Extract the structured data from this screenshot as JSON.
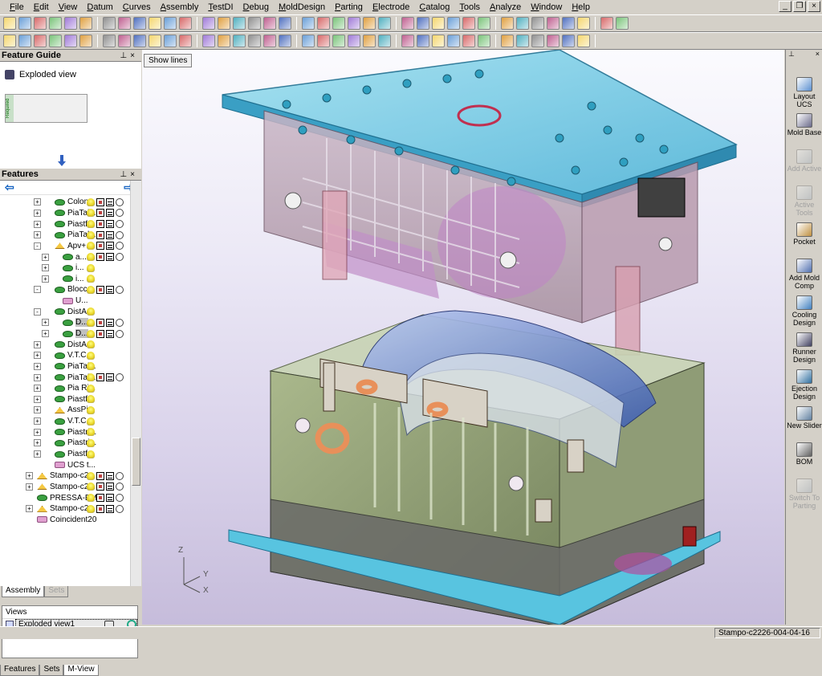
{
  "menu": [
    "File",
    "Edit",
    "View",
    "Datum",
    "Curves",
    "Assembly",
    "TestDI",
    "Debug",
    "MoldDesign",
    "Parting",
    "Electrode",
    "Catalog",
    "Tools",
    "Analyze",
    "Window",
    "Help"
  ],
  "feature_guide": {
    "title": "Feature Guide",
    "item": "Exploded view",
    "required_tag": "Required"
  },
  "features": {
    "title": "Features",
    "rows": [
      {
        "label": "Colon...",
        "depth": 2,
        "expander": "+",
        "icon": "green",
        "status": "full"
      },
      {
        "label": "PiaTal...",
        "depth": 2,
        "expander": "+",
        "icon": "green",
        "status": "full"
      },
      {
        "label": "Piastf...",
        "depth": 2,
        "expander": "+",
        "icon": "green",
        "status": "full"
      },
      {
        "label": "PiaTal...",
        "depth": 2,
        "expander": "+",
        "icon": "green",
        "status": "full"
      },
      {
        "label": "Apv+...",
        "depth": 2,
        "expander": "-",
        "icon": "tri",
        "status": "full"
      },
      {
        "label": "a...",
        "depth": 3,
        "expander": "+",
        "icon": "green",
        "status": "full"
      },
      {
        "label": "i...",
        "depth": 3,
        "expander": "+",
        "icon": "green",
        "status": "bulb"
      },
      {
        "label": "i...",
        "depth": 3,
        "expander": "+",
        "icon": "green",
        "status": "bulb"
      },
      {
        "label": "Blocc...",
        "depth": 2,
        "expander": "-",
        "icon": "green",
        "status": "full"
      },
      {
        "label": "U...",
        "depth": 3,
        "expander": "",
        "icon": "pink",
        "status": "none"
      },
      {
        "label": "DistA...",
        "depth": 2,
        "expander": "-",
        "icon": "green",
        "status": "bulb"
      },
      {
        "label": "D...",
        "depth": 3,
        "expander": "+",
        "icon": "green",
        "status": "full",
        "hl": true
      },
      {
        "label": "D...",
        "depth": 3,
        "expander": "+",
        "icon": "green",
        "status": "full",
        "hl": true
      },
      {
        "label": "DistA...",
        "depth": 2,
        "expander": "+",
        "icon": "green",
        "status": "bulb"
      },
      {
        "label": "V.T.C...",
        "depth": 2,
        "expander": "+",
        "icon": "green",
        "status": "bulb"
      },
      {
        "label": "PiaTal...",
        "depth": 2,
        "expander": "+",
        "icon": "green",
        "status": "bulb"
      },
      {
        "label": "PiaTal...",
        "depth": 2,
        "expander": "+",
        "icon": "green",
        "status": "full"
      },
      {
        "label": "Pia Ri...",
        "depth": 2,
        "expander": "+",
        "icon": "green",
        "status": "bulb"
      },
      {
        "label": "Piastf...",
        "depth": 2,
        "expander": "+",
        "icon": "green",
        "status": "bulb"
      },
      {
        "label": "AssPi...",
        "depth": 2,
        "expander": "+",
        "icon": "tri",
        "status": "bulb"
      },
      {
        "label": "V.T.C...",
        "depth": 2,
        "expander": "+",
        "icon": "green",
        "status": "bulb"
      },
      {
        "label": "Piastri...",
        "depth": 2,
        "expander": "+",
        "icon": "green",
        "status": "bulb"
      },
      {
        "label": "Piastri...",
        "depth": 2,
        "expander": "+",
        "icon": "green",
        "status": "bulb"
      },
      {
        "label": "Piastf...",
        "depth": 2,
        "expander": "+",
        "icon": "green",
        "status": "bulb"
      },
      {
        "label": "UCS t...",
        "depth": 2,
        "expander": "",
        "icon": "pink",
        "status": "none"
      },
      {
        "label": "Stampo-c2...",
        "depth": 1,
        "expander": "+",
        "icon": "tri",
        "status": "full"
      },
      {
        "label": "Stampo-c2...",
        "depth": 1,
        "expander": "+",
        "icon": "tri",
        "status": "full"
      },
      {
        "label": "PRESSA-BM...",
        "depth": 1,
        "expander": "",
        "icon": "green",
        "status": "full"
      },
      {
        "label": "Stampo-c2...",
        "depth": 1,
        "expander": "+",
        "icon": "tri",
        "status": "full"
      },
      {
        "label": "Coincident20",
        "depth": 1,
        "expander": "",
        "icon": "pink",
        "status": "none"
      }
    ]
  },
  "panel_tabs": [
    {
      "label": "Assembly",
      "active": true
    },
    {
      "label": "Sets",
      "active": false
    }
  ],
  "views": {
    "header": "Views",
    "selected": "Exploded view1"
  },
  "bottom_tabs": [
    {
      "label": "Features",
      "active": false
    },
    {
      "label": "Sets",
      "active": false
    },
    {
      "label": "M-View",
      "active": true
    }
  ],
  "viewport": {
    "show_lines_label": "Show lines",
    "axes": {
      "z": "Z",
      "y": "Y",
      "x": "X"
    }
  },
  "right_toolbar": [
    {
      "label": "Layout UCS",
      "enabled": true,
      "color": "#5a8fd0"
    },
    {
      "label": "Mold Base",
      "enabled": true,
      "color": "#6a6a8a"
    },
    {
      "label": "Add Active",
      "enabled": false,
      "color": "#9aaabb"
    },
    {
      "label": "Active Tools",
      "enabled": false,
      "color": "#9aaabb"
    },
    {
      "label": "Pocket",
      "enabled": true,
      "color": "#c09040"
    },
    {
      "label": "Add Mold Comp",
      "enabled": true,
      "color": "#5070b0"
    },
    {
      "label": "Cooling Design",
      "enabled": true,
      "color": "#4080c0"
    },
    {
      "label": "Runner Design",
      "enabled": true,
      "color": "#404060"
    },
    {
      "label": "Ejection Design",
      "enabled": true,
      "color": "#3070a0"
    },
    {
      "label": "New Slider",
      "enabled": true,
      "color": "#6080a0"
    },
    {
      "label": "BOM",
      "enabled": true,
      "color": "#606060"
    },
    {
      "label": "Switch To Parting",
      "enabled": false,
      "color": "#9aaabb"
    }
  ],
  "status": {
    "file": "Stampo-c2226-004-04-16"
  },
  "colors": {
    "accent": "#1060c0",
    "plate": "#5ec8e8",
    "body": "#a8b490",
    "viewport_bottom": "#c6bcdb"
  }
}
